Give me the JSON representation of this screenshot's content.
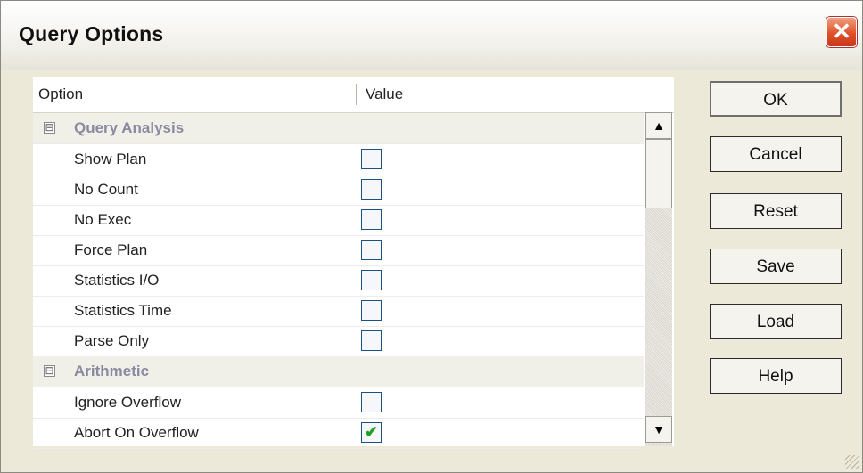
{
  "window": {
    "title": "Query Options",
    "close_symbol": "✕"
  },
  "list": {
    "columns": [
      "Option",
      "Value"
    ],
    "categories": [
      {
        "expander": "⊟",
        "label": "Query Analysis"
      },
      {
        "expander": "⊟",
        "label": "Arithmetic"
      }
    ],
    "options": [
      {
        "label": "Show Plan",
        "checked": false,
        "mark": ""
      },
      {
        "label": "No Count",
        "checked": false,
        "mark": ""
      },
      {
        "label": "No Exec",
        "checked": false,
        "mark": ""
      },
      {
        "label": "Force Plan",
        "checked": false,
        "mark": ""
      },
      {
        "label": "Statistics I/O",
        "checked": false,
        "mark": ""
      },
      {
        "label": "Statistics Time",
        "checked": false,
        "mark": ""
      },
      {
        "label": "Parse Only",
        "checked": false,
        "mark": ""
      },
      {
        "label": "Ignore Overflow",
        "checked": false,
        "mark": ""
      },
      {
        "label": "Abort On Overflow",
        "checked": true,
        "mark": "✔"
      }
    ]
  },
  "scrollbar": {
    "up_arrow": "▲",
    "down_arrow": "▼"
  },
  "buttons": {
    "ok": "OK",
    "cancel": "Cancel",
    "reset": "Reset",
    "save": "Save",
    "load": "Load",
    "help": "Help"
  },
  "colors": {
    "titlebar": "#f4f3ee",
    "dialog_bg": "#ece9d8",
    "close": "#e0502a",
    "checkbox_border": "#1c5180",
    "check": "#21a121",
    "category_text": "#8a8aa0"
  },
  "icons": {
    "close": "close-icon",
    "expander": "collapse-icon",
    "check": "checkmark-icon"
  }
}
